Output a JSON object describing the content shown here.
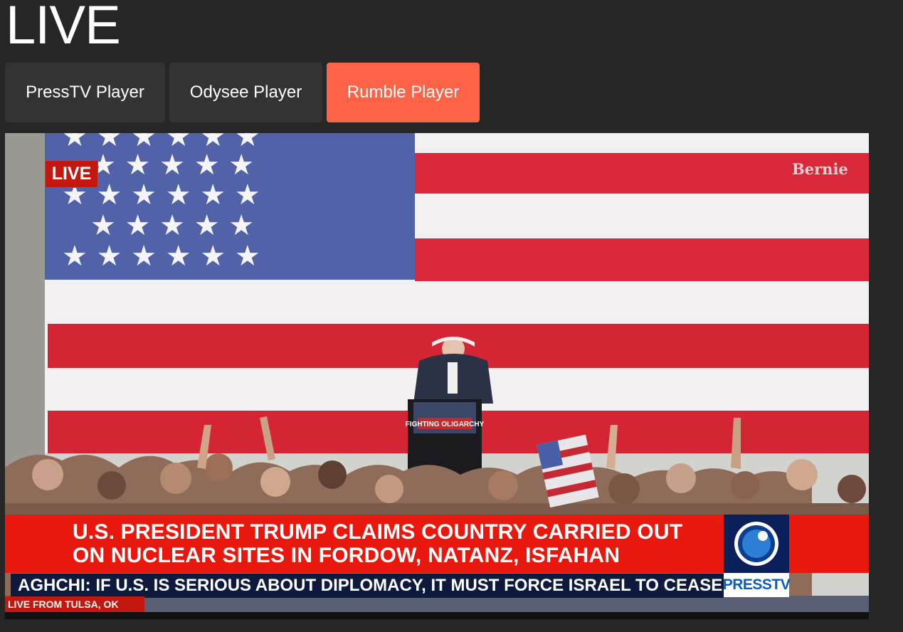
{
  "page": {
    "title": "LIVE"
  },
  "tabs": [
    {
      "label": "PressTV Player",
      "active": false
    },
    {
      "label": "Odysee Player",
      "active": false
    },
    {
      "label": "Rumble Player",
      "active": true
    }
  ],
  "colors": {
    "background": "#262626",
    "tab_inactive": "#333333",
    "tab_active": "#ff6347",
    "news_red": "#e8180e",
    "ticker_navy": "#0d1a3d"
  },
  "player": {
    "live_badge": "LIVE",
    "watermark": "Bernie",
    "podium_sign": "FIGHTING OLIGARCHY",
    "headline_line1": "U.S. PRESIDENT TRUMP CLAIMS COUNTRY CARRIED OUT",
    "headline_line2": "ON NUCLEAR SITES IN FORDOW, NATANZ, ISFAHAN",
    "ticker": "AGHCHI: IF U.S. IS SERIOUS ABOUT DIPLOMACY, IT MUST FORCE ISRAEL TO CEASE",
    "location": "LIVE FROM TULSA, OK",
    "logo_text": "PRESSTV",
    "logo_icon": "presstv-globe-icon"
  }
}
